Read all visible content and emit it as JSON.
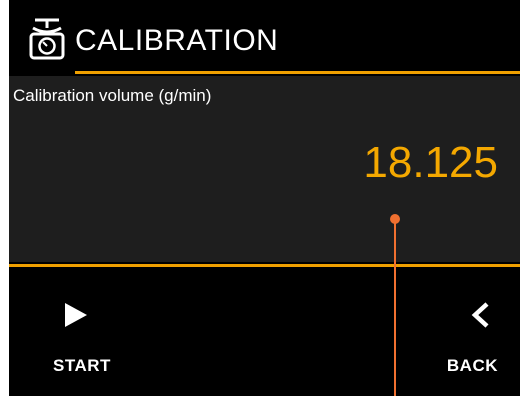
{
  "header": {
    "title": "CALIBRATION",
    "icon": "scale-icon"
  },
  "calibration": {
    "label": "Calibration volume (g/min)",
    "value": "18.125"
  },
  "buttons": {
    "start": {
      "label": "START",
      "icon": "play-icon"
    },
    "back": {
      "label": "BACK",
      "icon": "chevron-left-icon"
    }
  },
  "colors": {
    "background": "#000000",
    "panel": "#1e1e1e",
    "accent": "#f0a000",
    "value_text": "#f4a800",
    "pointer": "#f07030",
    "text": "#ffffff"
  }
}
